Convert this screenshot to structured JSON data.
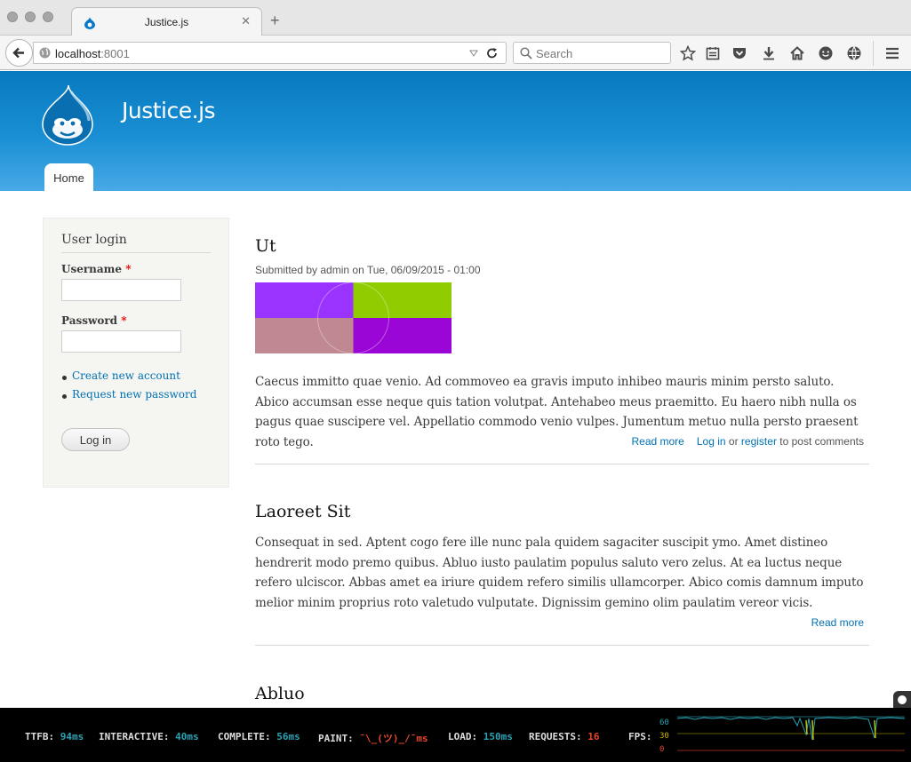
{
  "browser": {
    "tab_title": "Justice.js",
    "tab_close": "✕",
    "new_tab": "+",
    "url_host": "localhost",
    "url_port": ":8001",
    "search_placeholder": "Search"
  },
  "site": {
    "name": "Justice.js",
    "nav_home": "Home"
  },
  "login_block": {
    "title": "User login",
    "username_label": "Username",
    "password_label": "Password",
    "required_mark": "*",
    "create_account": "Create new account",
    "request_password": "Request new password",
    "login_button": "Log in"
  },
  "articles": [
    {
      "title": "Ut",
      "submitted": "Submitted by admin on Tue, 06/09/2015 - 01:00",
      "body": "Caecus immitto quae venio. Ad commoveo ea gravis imputo inhibeo mauris minim persto saluto. Abico accumsan esse neque quis tation volutpat. Antehabeo meus praemitto. Eu haero nibh nulla os pagus quae suscipere vel. Appellatio commodo venio vulpes. Jumentum metuo nulla persto praesent roto tego.",
      "read_more": "Read more",
      "log_in": "Log in",
      "or": "or",
      "register": "register",
      "post_comments": "to post comments",
      "image_colors": [
        "#9b33ff",
        "#8fcc00",
        "#c08890",
        "#9a06d6"
      ]
    },
    {
      "title": "Laoreet Sit",
      "body": "Consequat in sed. Aptent cogo fere ille nunc pala quidem sagaciter suscipit ymo. Amet distineo hendrerit modo premo quibus. Abluo iusto paulatim populus saluto vero zelus. At ea luctus neque refero ulciscor. Abbas amet ea iriure quidem refero similis ullamcorper. Abico comis damnum imputo melior minim proprius roto valetudo vulputate. Dignissim gemino olim paulatim vereor vicis.",
      "read_more": "Read more"
    },
    {
      "title": "Abluo"
    }
  ],
  "perf": {
    "ttfb_label": "TTFB:",
    "ttfb": "94ms",
    "interactive_label": "INTERACTIVE:",
    "interactive": "40ms",
    "complete_label": "COMPLETE:",
    "complete": "56ms",
    "paint_label": "PAINT:",
    "paint": "¯\\_(ツ)_/¯ms",
    "load_label": "LOAD:",
    "load": "150ms",
    "requests_label": "REQUESTS:",
    "requests": "16",
    "fps_label": "FPS:",
    "fps_axis": [
      "60",
      "30",
      "0"
    ],
    "fps_axis_colors": [
      "#2aa3b5",
      "#c8b400",
      "#e8452c"
    ]
  },
  "colors": {
    "header_blue": "#0779bf",
    "link_blue": "#0071b3"
  }
}
